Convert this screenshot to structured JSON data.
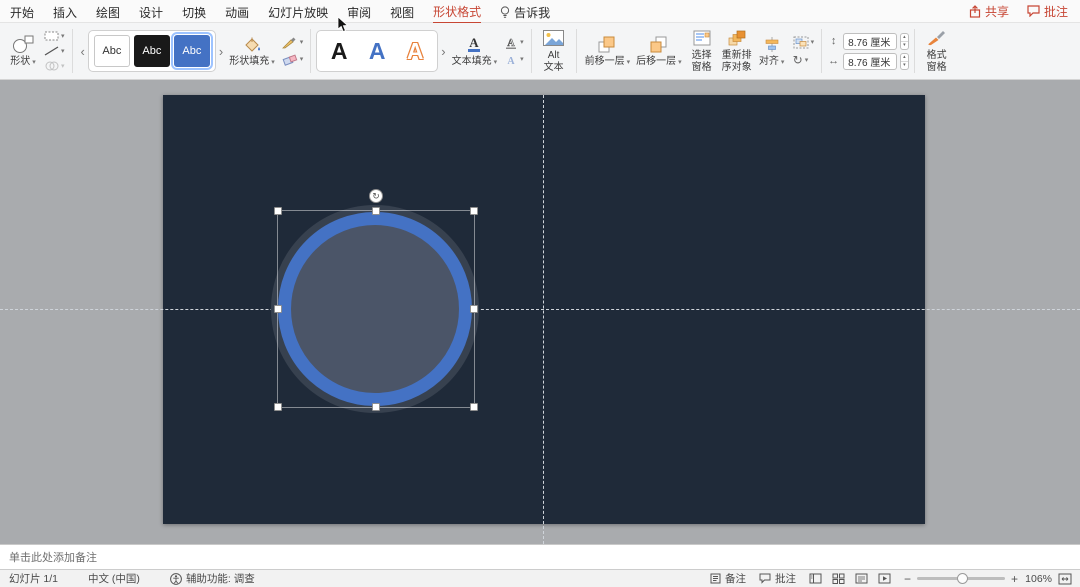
{
  "colors": {
    "accent": "#c74634",
    "office_blue": "#4472c4",
    "canvas_bg": "#a9abae",
    "slide_bg": "#1f2a39",
    "shape_ring": "#4472c4",
    "shape_fill": "#4b5568",
    "shape_glow": "#37414f"
  },
  "icons": {
    "dropdown": "▾",
    "gallery_prev": "‹",
    "gallery_next": "›",
    "rotate": "↻",
    "height": "↕",
    "width": "↔",
    "zoom_out": "−",
    "zoom_in": "+",
    "stepper_up": "▴",
    "stepper_down": "▾"
  },
  "menubar": {
    "tabs": [
      {
        "label": "开始"
      },
      {
        "label": "插入"
      },
      {
        "label": "绘图"
      },
      {
        "label": "设计"
      },
      {
        "label": "切换"
      },
      {
        "label": "动画"
      },
      {
        "label": "幻灯片放映"
      },
      {
        "label": "审阅"
      },
      {
        "label": "视图"
      },
      {
        "label": "形状格式",
        "active": true
      },
      {
        "label": "告诉我"
      }
    ],
    "share_label": "共享",
    "comments_label": "批注"
  },
  "ribbon": {
    "shapes_label": "形状",
    "style_gallery": [
      "Abc",
      "Abc",
      "Abc"
    ],
    "style_selected_index": 2,
    "shape_fill_label": "形状填充",
    "wordart_gallery": [
      "A",
      "A",
      "A"
    ],
    "text_fill_label": "文本填充",
    "alt_text": {
      "line1": "Alt",
      "line2": "文本"
    },
    "arrange": {
      "bring_forward": "前移一层",
      "send_backward": "后移一层",
      "selection_pane": {
        "line1": "选择",
        "line2": "窗格"
      },
      "reorder": {
        "line1": "重新排",
        "line2": "序对象"
      },
      "align": "对齐"
    },
    "size": {
      "height_value": "8.76 厘米",
      "width_value": "8.76 厘米"
    },
    "format_pane": {
      "line1": "格式",
      "line2": "窗格"
    }
  },
  "notes": {
    "placeholder": "单击此处添加备注"
  },
  "statusbar": {
    "slide_indicator": "幻灯片 1/1",
    "language": "中文 (中国)",
    "accessibility": "辅助功能: 调查",
    "notes_label": "备注",
    "comments_label": "批注",
    "zoom_level": "106%"
  }
}
